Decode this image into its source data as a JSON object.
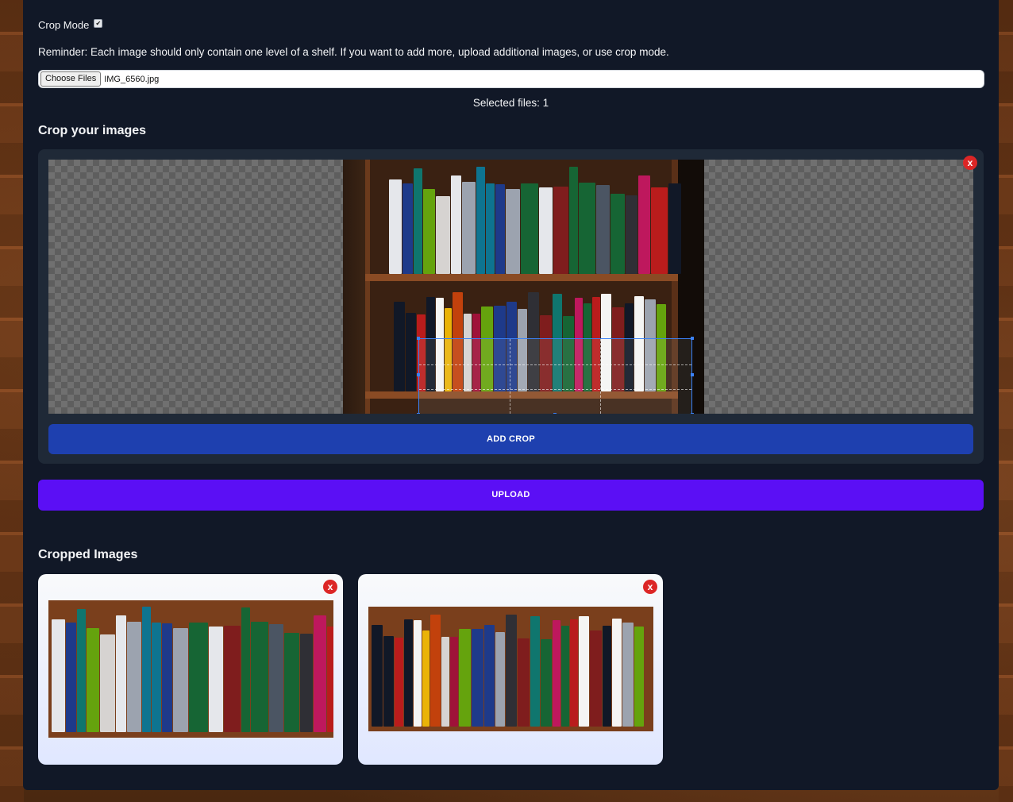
{
  "crop_mode": {
    "label": "Crop Mode",
    "checked": true,
    "check_glyph": "✔"
  },
  "reminder": "Reminder: Each image should only contain one level of a shelf. If you want to add more, upload additional images, or use crop mode.",
  "file_input": {
    "button_label": "Choose Files",
    "file_name": "IMG_6560.jpg"
  },
  "selected_files": "Selected files: 1",
  "crop_section": {
    "title": "Crop your images",
    "remove_label": "x",
    "add_crop_label": "ADD CROP"
  },
  "upload_label": "UPLOAD",
  "cropped_section": {
    "title": "Cropped Images",
    "cards": [
      {
        "remove_label": "x"
      },
      {
        "remove_label": "x"
      }
    ]
  },
  "colors": {
    "panel_bg": "#111827",
    "crop_box_bg": "#1f2937",
    "add_crop_bg": "#1e40af",
    "upload_bg": "#5b0ff5",
    "remove_bg": "#dc2626",
    "crop_border": "#3b82f6"
  }
}
